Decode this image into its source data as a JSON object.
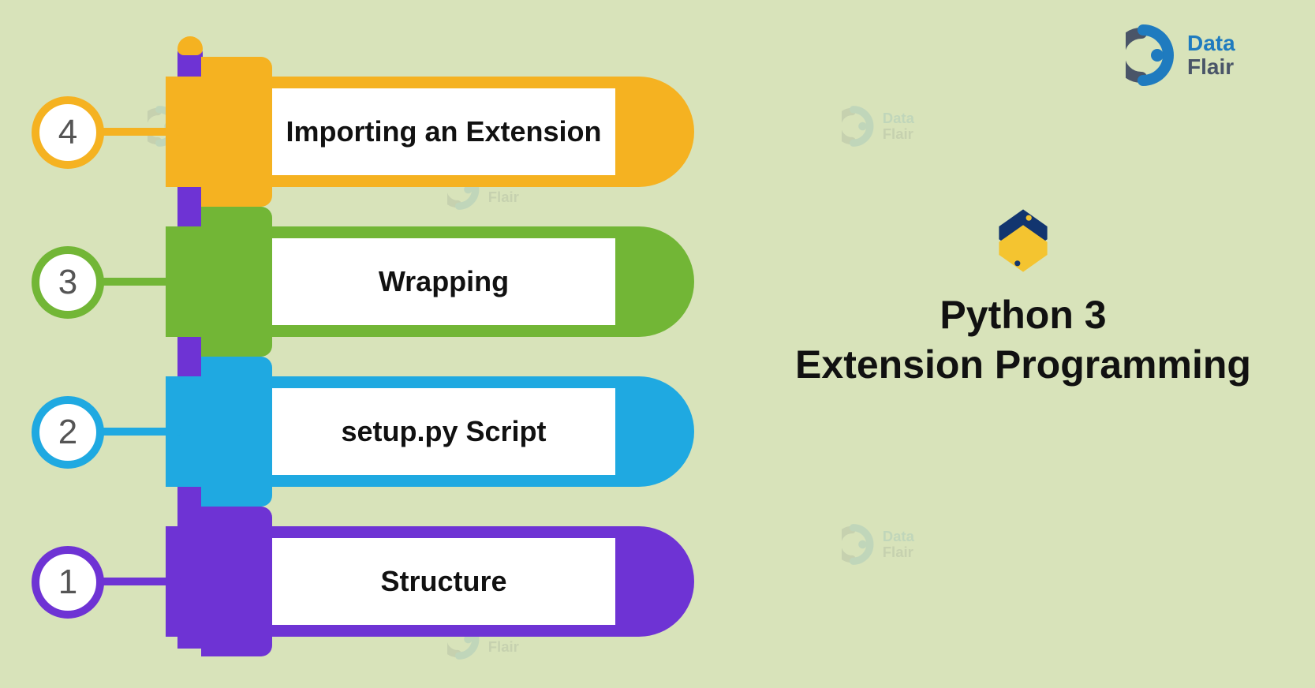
{
  "brand": {
    "name_line1": "Data",
    "name_line2": "Flair"
  },
  "title": {
    "line1": "Python 3",
    "line2": "Extension Programming"
  },
  "colors": {
    "orange": "#f5b221",
    "green": "#72b636",
    "blue": "#1fa9e1",
    "violet": "#6e33d4",
    "bg": "#d8e3ba"
  },
  "steps": [
    {
      "number": "4",
      "label": "Importing an Extension",
      "color": "orange"
    },
    {
      "number": "3",
      "label": "Wrapping",
      "color": "green"
    },
    {
      "number": "2",
      "label": "setup.py Script",
      "color": "blue"
    },
    {
      "number": "1",
      "label": "Structure",
      "color": "violet"
    }
  ],
  "icons": {
    "python_logo": "python-logo-icon",
    "brand_logo": "dataflair-logo-icon"
  }
}
